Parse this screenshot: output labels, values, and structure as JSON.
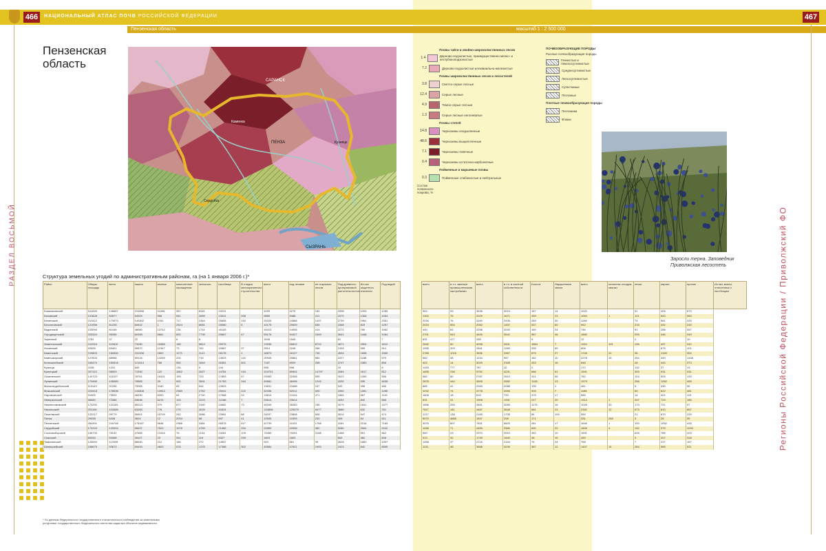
{
  "header": {
    "page_left": "466",
    "page_right": "467",
    "running_title_bold": "НАЦИОНАЛЬНЫЙ АТЛАС ПОЧВ",
    "running_title_rest": "РОССИЙСКОЙ ФЕДЕРАЦИИ",
    "region": "Пензенская область",
    "scale": "масштаб 1 : 2 500 000"
  },
  "title": "Пензенская область",
  "side_left": "РАЗДЕЛ ВОСЬМОЙ",
  "side_right": "Регионы Российской Федерации / Приволжский ФО",
  "map_labels": {
    "city1": "САРАНСК",
    "city2": "ПЕНЗА",
    "city3": "СЫЗРАНЬ",
    "city4": "Кузнецк",
    "city5": "Сердобск",
    "city6": "Каменка"
  },
  "legend": {
    "head1": "Почвы тайги и хвойно-широколиственных лесов",
    "rows1": [
      {
        "val": "1.4",
        "color": "#f3c9d8",
        "text": "Дерново-подзолистые, преимущественно мелко- и неглубокоподзолистые"
      },
      {
        "val": "7.2",
        "color": "#e8a9b8",
        "text": "Дерново-подзолистые иллювиально-железистые"
      }
    ],
    "head2": "Почвы широколиственных лесов и лесостепей",
    "rows2": [
      {
        "val": "3.8",
        "color": "#f0d0d0",
        "text": "Светло-серые лесные"
      },
      {
        "val": "12.4",
        "color": "#d9a3a8",
        "text": "Серые лесные"
      },
      {
        "val": "4.9",
        "color": "#b8666f",
        "text": "Темно-серые лесные"
      },
      {
        "val": "1.3",
        "color": "#c87a84",
        "text": "Серые лесные неглееватые"
      }
    ],
    "head3": "Почвы степей",
    "rows3": [
      {
        "val": "14.8",
        "color": "#d98fc0",
        "text": "Черноземы оподзоленные"
      },
      {
        "val": "48.6",
        "color": "#9c2f3c",
        "text": "Черноземы выщелоченные"
      },
      {
        "val": "7.1",
        "color": "#7a1f2a",
        "text": "Черноземы типичные"
      },
      {
        "val": "0.4",
        "color": "#b5627a",
        "text": "Черноземы остаточно-карбонатные"
      }
    ],
    "head4": "Пойменные и маршевые почвы",
    "rows4": [
      {
        "val": "0.3",
        "color": "#b5e0b0",
        "text": "Пойменные слабокислые и нейтральные"
      }
    ],
    "note": "Состав почвенного покрова, %"
  },
  "legend2": {
    "head": "ПОЧВООБРАЗУЮЩИЕ ПОРОДЫ",
    "subhead": "Рыхлые почвообразующие породы",
    "rows": [
      {
        "text": "Глинистые и тяжелосуглинистые"
      },
      {
        "text": "Среднесуглинистые"
      },
      {
        "text": "Легкосуглинистые"
      },
      {
        "text": "Супесчаные"
      },
      {
        "text": "Песчаные"
      }
    ],
    "subhead2": "Плотные почвообразующие породы",
    "rows2": [
      {
        "text": "Песчаники"
      },
      {
        "text": "Флюки"
      }
    ]
  },
  "photo_caption": "Заросли терна. Заповедник Приволжская лесостепь",
  "table": {
    "title": "Структура земельных угодий по административным районам, га (на 1 января 2006 г.)*",
    "left_headers": [
      "Район",
      "Общая площадь",
      "всего",
      "пашня",
      "залежь",
      "многолетние насаждения",
      "сенокосы",
      "пастбища",
      "В стадии мелиоративного строительства",
      "всего",
      "под лесами",
      "не покрытые лесом",
      "Под древесно-кустарниковой растительностью",
      "Из них защитного значения",
      "Под водой"
    ],
    "right_headers": [
      "всего",
      "в т.ч. занятые промышленными застройками",
      "всего",
      "в т.ч. в частной собственности",
      "Болота",
      "Нарушенные земли",
      "всего",
      "полигоны отходов, свалки",
      "пески",
      "овраги",
      "прочие",
      "Из них земли, отнесенные к пастбищам"
    ],
    "rows": [
      {
        "n": "Башмаковский",
        "l": [
          "161849",
          "146867",
          "104898",
          "11008",
          "367",
          "8181",
          "24231",
          "",
          "4459",
          "4275",
          "184",
          "3398",
          "1205",
          "1285"
        ],
        "r": [
          "964",
          "93",
          "3636",
          "3024",
          "187",
          "14",
          "1020",
          "",
          "51",
          "406",
          "670"
        ]
      },
      {
        "n": "Бековский",
        "l": [
          "101828",
          "82677",
          "64929",
          "968",
          "941",
          "2659",
          "13041",
          "268",
          "9869",
          "9488",
          "411",
          "2272",
          "1328",
          "1064"
        ],
        "r": [
          "1302",
          "76",
          "2029",
          "1671",
          "459",
          "23",
          "1054",
          "1",
          "121",
          "543",
          "383"
        ]
      },
      {
        "n": "Белинский",
        "l": [
          "212412",
          "173973",
          "140302",
          "4781",
          "717",
          "2364",
          "25808",
          "152",
          "20025",
          "24588",
          "1437",
          "2739",
          "1961",
          "2351"
        ],
        "r": [
          "2034",
          "76",
          "3160",
          "2435",
          "289",
          "30",
          "1260",
          "",
          "74",
          "961",
          "225"
        ]
      },
      {
        "n": "Бессоновский",
        "l": [
          "121956",
          "81228",
          "60542",
          "1",
          "2524",
          "8081",
          "15080",
          "6",
          "10175",
          "29539",
          "636",
          "2368",
          "819",
          "1257"
        ],
        "r": [
          "2024",
          "594",
          "2052",
          "1457",
          "537",
          "60",
          "952",
          "",
          "215",
          "332",
          "245"
        ]
      },
      {
        "n": "Вадинский",
        "l": [
          "103094",
          "81445",
          "48060",
          "13742",
          "236",
          "1741",
          "16163",
          "",
          "15413",
          "14908",
          "414",
          "2272",
          "760",
          "1562"
        ],
        "r": [
          "440",
          "63",
          "2258",
          "2020",
          "160",
          "24",
          "746",
          "",
          "91",
          "288",
          "267"
        ]
      },
      {
        "n": "Городищенский",
        "l": [
          "205324",
          "95285",
          "60395",
          "5661",
          "820",
          "7739",
          "20667",
          "47",
          "95176",
          "94427",
          "1549",
          "3641",
          "1448",
          "1064"
        ],
        "r": [
          "2701",
          "543",
          "4626",
          "3542",
          "587",
          "46",
          "1660",
          "",
          "205",
          "446",
          "349"
        ]
      },
      {
        "n": "Заречный",
        "l": [
          "2761",
          "37",
          "22",
          "",
          "6",
          "8",
          "",
          "",
          "1545",
          "1545",
          "",
          "61",
          "",
          "7"
        ],
        "r": [
          "831",
          "477",
          "255",
          "",
          "9",
          "",
          "12",
          "",
          "2",
          "",
          "10"
        ]
      },
      {
        "n": "Земетчинский",
        "l": [
          "210316",
          "119612",
          "73280",
          "15385",
          "185",
          "5814",
          "25075",
          "",
          "74536",
          "65812",
          "8724",
          "4671",
          "2904",
          "1612"
        ],
        "r": [
          "2642",
          "60",
          "4098",
          "3431",
          "1864",
          "7",
          "1104",
          "119",
          "196",
          "497",
          "342"
        ]
      },
      {
        "n": "Иссинский",
        "l": [
          "92626",
          "83401",
          "59572",
          "12347",
          "73",
          "762",
          "10667",
          "97",
          "2514",
          "2246",
          "268",
          "1333",
          "959",
          "514"
        ],
        "r": [
          "1955",
          "203",
          "2841",
          "1283",
          "335",
          "59",
          "806",
          "",
          "",
          "675",
          "101"
        ]
      },
      {
        "n": "Каменский",
        "l": [
          "215803",
          "184050",
          "151008",
          "2800",
          "1173",
          "1141",
          "28178",
          "1",
          "18873",
          "18137",
          "736",
          "4534",
          "1658",
          "1550"
        ],
        "r": [
          "2789",
          "1016",
          "3836",
          "2967",
          "875",
          "27",
          "1746",
          "22",
          "36",
          "1349",
          "354"
        ]
      },
      {
        "n": "Камешкирский",
        "l": [
          "127833",
          "88958",
          "59134",
          "14259",
          "224",
          "715",
          "14523",
          "116",
          "20945",
          "20861",
          "584",
          "2227",
          "1188",
          "579"
        ],
        "r": [
          "582",
          "38",
          "1244",
          "957",
          "162",
          "10",
          "2278",
          "15",
          "254",
          "349",
          "1448"
        ]
      },
      {
        "n": "Колышлейский",
        "l": [
          "166470",
          "150518",
          "121614",
          "786",
          "550",
          "1649",
          "26381",
          "601",
          "7187",
          "6929",
          "258",
          "3747",
          "2383",
          "806"
        ],
        "r": [
          "402",
          "14",
          "3025",
          "2345",
          "253",
          "16",
          "848",
          "",
          "28",
          "444",
          "373"
        ]
      },
      {
        "n": "Кузнеца",
        "l": [
          "4158",
          "1231",
          "849",
          "",
          "134",
          "5",
          "144",
          "",
          "598",
          "598",
          "",
          "19",
          "",
          "8"
        ],
        "r": [
          "1453",
          "777",
          "787",
          "42",
          "2",
          "",
          "172",
          "",
          "132",
          "27",
          "13"
        ]
      },
      {
        "n": "Кузнецкий",
        "l": [
          "207113",
          "98903",
          "71530",
          "122",
          "1652",
          "2627",
          "14764",
          "118",
          "104701",
          "89904",
          "14797",
          "2084",
          "1817",
          "812"
        ],
        "r": [
          "1895",
          "238",
          "5752",
          "4231",
          "686",
          "51",
          "1591",
          "",
          "309",
          "931",
          "331"
        ]
      },
      {
        "n": "Лопатинский",
        "l": [
          "144723",
          "111927",
          "78761",
          "16431",
          "159",
          "723",
          "17853",
          "47",
          "23083",
          "22308",
          "595",
          "3021",
          "1265",
          "556"
        ],
        "r": [
          "582",
          "80",
          "2787",
          "2510",
          "321",
          "55",
          "762",
          "",
          "124",
          "525",
          "133"
        ]
      },
      {
        "n": "Лунинский",
        "l": [
          "170469",
          "106080",
          "78585",
          "39",
          "902",
          "3591",
          "21783",
          "344",
          "49681",
          "48436",
          "1245",
          "4332",
          "939",
          "1635"
        ],
        "r": [
          "2878",
          "444",
          "3605",
          "2682",
          "1128",
          "13",
          "1973",
          "",
          "256",
          "1262",
          "455"
        ]
      },
      {
        "n": "Малосердобинский",
        "l": [
          "110143",
          "91256",
          "75065",
          "3180",
          "65",
          "544",
          "12603",
          "",
          "13631",
          "13488",
          "157",
          "943",
          "496",
          "466"
        ],
        "r": [
          "885",
          "42",
          "2283",
          "2088",
          "135",
          "1",
          "481",
          "",
          "5",
          "330",
          "96"
        ]
      },
      {
        "n": "Мокшанский",
        "l": [
          "223418",
          "178536",
          "134808",
          "13944",
          "2389",
          "2752",
          "25041",
          "222",
          "32336",
          "32011",
          "325",
          "2330",
          "1281",
          "1285"
        ],
        "r": [
          "1232",
          "74",
          "4778",
          "4055",
          "539",
          "7",
          "1186",
          "",
          "83",
          "622",
          "481"
        ]
      },
      {
        "n": "Наровчатский",
        "l": [
          "91695",
          "75533",
          "46930",
          "8260",
          "64",
          "2740",
          "17568",
          "24",
          "13614",
          "13144",
          "471",
          "1584",
          "587",
          "1116"
        ],
        "r": [
          "1808",
          "18",
          "616",
          "733",
          "475",
          "17",
          "585",
          "",
          "14",
          "401",
          "115"
        ]
      },
      {
        "n": "Неверкинский",
        "l": [
          "98460",
          "72366",
          "53635",
          "5219",
          "103",
          "2223",
          "12186",
          "7",
          "20614",
          "20614",
          "",
          "1631",
          "832",
          "668"
        ],
        "r": [
          "831",
          "31",
          "1906",
          "1391",
          "217",
          "20",
          "1312",
          "1",
          "397",
          "729",
          "186"
        ]
      },
      {
        "n": "Нижнеломовский",
        "l": [
          "170252",
          "124181",
          "85213",
          "970",
          "877",
          "2440",
          "24662",
          "73",
          "40049",
          "35283",
          "766",
          "3079",
          "1641",
          "1377"
        ],
        "r": [
          "1856",
          "255",
          "3461",
          "3065",
          "1175",
          "16",
          "1026",
          "33",
          "173",
          "721",
          "97"
        ]
      },
      {
        "n": "Никольский",
        "l": [
          "251190",
          "102685",
          "63283",
          "778",
          "275",
          "4025",
          "34324",
          "",
          "134856",
          "125379",
          "9477",
          "3889",
          "632",
          "761"
        ],
        "r": [
          "7617",
          "181",
          "4487",
          "3648",
          "581",
          "23",
          "2352",
          "12",
          "673",
          "610",
          "857"
        ]
      },
      {
        "n": "Пачелмский",
        "l": [
          "132217",
          "99779",
          "55901",
          "16709",
          "262",
          "3086",
          "23981",
          "88",
          "24037",
          "23808",
          "508",
          "2814",
          "947",
          "474"
        ],
        "r": [
          "1217",
          "138",
          "2165",
          "1735",
          "84",
          "109",
          "950",
          "",
          "21",
          "670",
          "239"
        ]
      },
      {
        "n": "Пенза",
        "l": [
          "29038",
          "6436",
          "3604",
          "12",
          "2034",
          "88",
          "697",
          "41",
          "10535",
          "10305",
          "230",
          "408",
          "54",
          "611"
        ],
        "r": [
          "9070",
          "4865",
          "1847",
          "208",
          "171",
          "",
          "331",
          "268",
          "3",
          "25",
          "35"
        ]
      },
      {
        "n": "Пензенский",
        "l": [
          "284491",
          "216748",
          "178167",
          "5646",
          "2988",
          "3381",
          "26575",
          "517",
          "42799",
          "41031",
          "1768",
          "4181",
          "2216",
          "7183"
        ],
        "r": [
          "3075",
          "607",
          "7831",
          "5825",
          "281",
          "17",
          "1640",
          "1",
          "153",
          "1052",
          "435"
        ]
      },
      {
        "n": "Сердобский",
        "l": [
          "172243",
          "133204",
          "98437",
          "7523",
          "1078",
          "4755",
          "21462",
          "254",
          "22890",
          "22508",
          "382",
          "5280",
          "2504",
          "2242"
        ],
        "r": [
          "1456",
          "71",
          "4459",
          "3389",
          "690",
          "22",
          "1606",
          "4",
          "132",
          "375",
          "1093"
        ]
      },
      {
        "n": "Сосновоборский",
        "l": [
          "156734",
          "75132",
          "47665",
          "13194",
          "76",
          "1134",
          "13261",
          "109",
          "73459",
          "70291",
          "3168",
          "1468",
          "551",
          "562"
        ],
        "r": [
          "560",
          "23",
          "2370",
          "2010",
          "452",
          "10",
          "1591",
          "",
          "628",
          "785",
          "203"
        ]
      },
      {
        "n": "Спасский",
        "l": [
          "60033",
          "53458",
          "39427",
          "23",
          "551",
          "119",
          "8327",
          "259",
          "1803",
          "1803",
          "",
          "653",
          "382",
          "808"
        ],
        "r": [
          "313",
          "32",
          "1749",
          "1640",
          "38",
          "16",
          "459",
          "",
          "3",
          "207",
          "228"
        ]
      },
      {
        "n": "Тамалинский",
        "l": [
          "125594",
          "113939",
          "88530",
          "212",
          "166",
          "272",
          "14557",
          "",
          "920",
          "881",
          "39",
          "2628",
          "1863",
          "1097"
        ],
        "r": [
          "1458",
          "37",
          "2715",
          "2154",
          "76",
          "24",
          "768",
          "",
          "7",
          "237",
          "167"
        ]
      },
      {
        "n": "Шемышейский",
        "l": [
          "158675",
          "93673",
          "69493",
          "4820",
          "678",
          "1376",
          "17386",
          "302",
          "49584",
          "47521",
          "1993",
          "1923",
          "642",
          "6559"
        ],
        "r": [
          "1131",
          "48",
          "3558",
          "3239",
          "387",
          "12",
          "1407",
          "14",
          "284",
          "589",
          "521"
        ]
      }
    ],
    "footnote": "* По данным Федерального государственного статистического наблюдения за земельными ресурсами, государственного Федерального агентства кадастра объектов недвижимости."
  },
  "colors": {
    "gold": "#e3c322",
    "maroon": "#9a1b1b",
    "pale_yellow": "#fbf6c6"
  }
}
